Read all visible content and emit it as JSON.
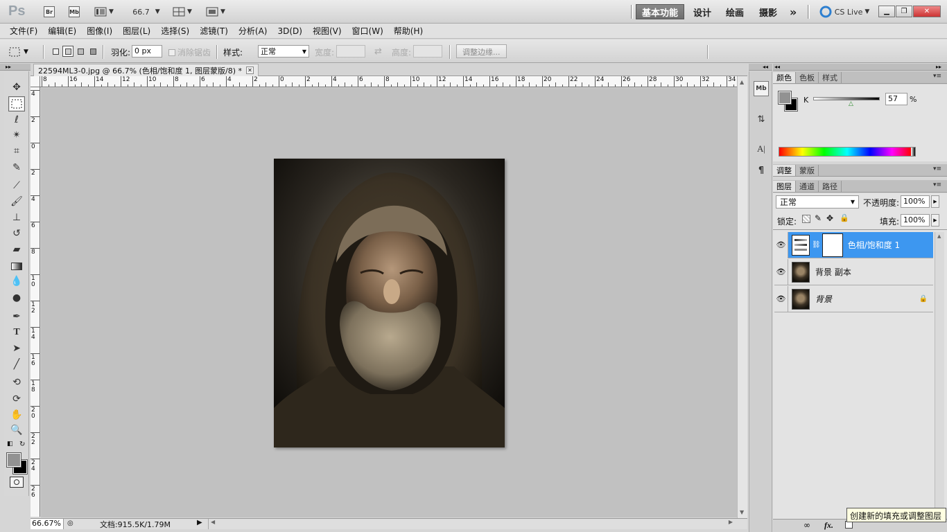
{
  "app": {
    "logo": "Ps",
    "bridge_label": "Br",
    "minibridge_label": "Mb",
    "zoom_value": "66.7",
    "workspaces": [
      "基本功能",
      "设计",
      "绘画",
      "摄影"
    ],
    "more_label": "»",
    "cs_live": "CS Live"
  },
  "menu": [
    "文件(F)",
    "编辑(E)",
    "图像(I)",
    "图层(L)",
    "选择(S)",
    "滤镜(T)",
    "分析(A)",
    "3D(D)",
    "视图(V)",
    "窗口(W)",
    "帮助(H)"
  ],
  "options": {
    "feather_label": "羽化:",
    "feather_value": "0 px",
    "antialias_label": "消除锯齿",
    "style_label": "样式:",
    "style_value": "正常",
    "width_label": "宽度:",
    "height_label": "高度:",
    "refine_button": "调整边缘..."
  },
  "document": {
    "tab_title": "22594ML3-0.jpg @ 66.7% (色相/饱和度 1, 图层蒙版/8) *",
    "zoom_status": "66.67%",
    "doc_info": "文档:915.5K/1.79M",
    "ruler_top_labels": [
      "8",
      "16",
      "14",
      "12",
      "10",
      "8",
      "6",
      "4",
      "2",
      "0",
      "2",
      "4",
      "6",
      "8",
      "10",
      "12",
      "14",
      "16",
      "18",
      "20",
      "22",
      "24",
      "26",
      "28",
      "30",
      "32",
      "34"
    ],
    "ruler_left_labels": [
      "4",
      "2",
      "0",
      "2",
      "4",
      "6",
      "8",
      "1 0",
      "1 2",
      "1 4",
      "1 6",
      "1 8",
      "2 0",
      "2 2",
      "2 4",
      "2 6"
    ]
  },
  "color_panel": {
    "tabs": [
      "颜色",
      "色板",
      "样式"
    ],
    "channel_label": "K",
    "channel_value": "57",
    "percent": "%",
    "slider_level": 0.57
  },
  "adjust_panel": {
    "tabs": [
      "调整",
      "蒙版"
    ]
  },
  "layers_panel": {
    "tabs": [
      "图层",
      "通道",
      "路径"
    ],
    "blend_mode": "正常",
    "opacity_label": "不透明度:",
    "opacity_value": "100%",
    "lock_label": "锁定:",
    "fill_label": "填充:",
    "fill_value": "100%",
    "layers": [
      {
        "name": "色相/饱和度 1",
        "selected": true
      },
      {
        "name": "背景 副本",
        "selected": false
      },
      {
        "name": "背景",
        "selected": false,
        "italic": true
      }
    ],
    "footer_fx": "fx."
  },
  "tooltip": "创建新的填充或调整图层",
  "colors": {
    "accent": "#3d97f0",
    "foreground": "#929292",
    "background": "#000000"
  }
}
